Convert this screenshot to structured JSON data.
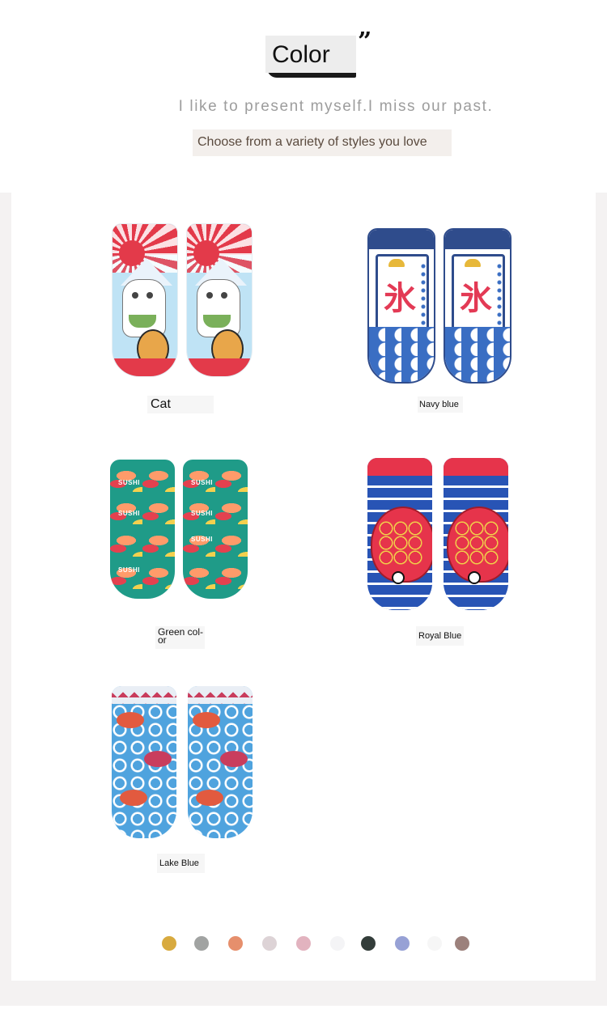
{
  "header": {
    "title": "Color",
    "subtitle": "I like to present myself.I miss our past.",
    "tagline": "Choose from a variety of styles you love"
  },
  "products": [
    {
      "label": "Cat",
      "design": "maneki-neko-fuji"
    },
    {
      "label": "Navy blue",
      "design": "kakigori-flag-waves"
    },
    {
      "label": "Green col-\nor",
      "design": "sushi-pattern"
    },
    {
      "label": "Royal Blue",
      "design": "red-fish-waves"
    },
    {
      "label": "Lake Blue",
      "design": "koi-waves"
    }
  ],
  "navy_kanji": "氷",
  "sushi_text": "SUSHI",
  "swatches": [
    {
      "color": "#d8aa3f"
    },
    {
      "color": "#a1a3a2"
    },
    {
      "color": "#e68f6c"
    },
    {
      "color": "#ddd3d6"
    },
    {
      "color": "#e2b3bf"
    },
    {
      "color": "#f4f4f6"
    },
    {
      "color": "#333d3a"
    },
    {
      "color": "#97a1d5"
    },
    {
      "color": "#f6f6f6"
    },
    {
      "color": "#9c817c"
    }
  ]
}
